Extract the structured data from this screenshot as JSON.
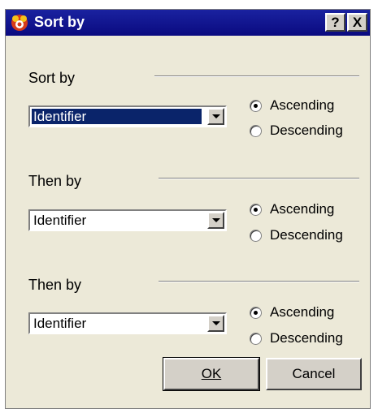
{
  "window": {
    "title": "Sort by",
    "help_button": "?",
    "close_button": "X"
  },
  "sections": [
    {
      "label": "Sort by",
      "field": "Identifier",
      "options": [
        "Ascending",
        "Descending"
      ],
      "selected": "Ascending"
    },
    {
      "label": "Then by",
      "field": "Identifier",
      "options": [
        "Ascending",
        "Descending"
      ],
      "selected": "Ascending"
    },
    {
      "label": "Then by",
      "field": "Identifier",
      "options": [
        "Ascending",
        "Descending"
      ],
      "selected": "Ascending"
    }
  ],
  "buttons": {
    "ok": "OK",
    "cancel": "Cancel"
  }
}
